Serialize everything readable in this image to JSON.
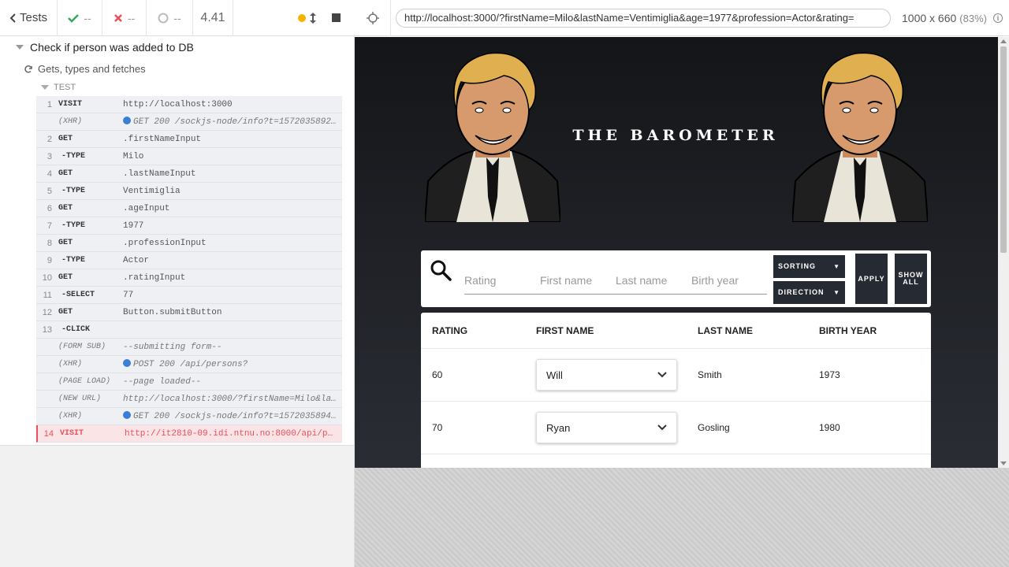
{
  "reporter": {
    "back_label": "Tests",
    "passed": "--",
    "failed": "--",
    "pending": "--",
    "duration": "4.41",
    "suite_title": "Check if person was added to DB",
    "test_title": "Gets, types and fetches",
    "section_label": "TEST",
    "commands": [
      {
        "num": "1",
        "name": "VISIT",
        "msg": "http://localhost:3000",
        "kind": "cmd"
      },
      {
        "num": "",
        "name": "(XHR)",
        "msg": "GET 200 /sockjs-node/info?t=1572035892…",
        "kind": "xhr"
      },
      {
        "num": "2",
        "name": "GET",
        "msg": ".firstNameInput",
        "kind": "cmd"
      },
      {
        "num": "3",
        "name": "-TYPE",
        "msg": "Milo",
        "kind": "child"
      },
      {
        "num": "4",
        "name": "GET",
        "msg": ".lastNameInput",
        "kind": "cmd"
      },
      {
        "num": "5",
        "name": "-TYPE",
        "msg": "Ventimiglia",
        "kind": "child"
      },
      {
        "num": "6",
        "name": "GET",
        "msg": ".ageInput",
        "kind": "cmd"
      },
      {
        "num": "7",
        "name": "-TYPE",
        "msg": "1977",
        "kind": "child"
      },
      {
        "num": "8",
        "name": "GET",
        "msg": ".professionInput",
        "kind": "cmd"
      },
      {
        "num": "9",
        "name": "-TYPE",
        "msg": "Actor",
        "kind": "child"
      },
      {
        "num": "10",
        "name": "GET",
        "msg": ".ratingInput",
        "kind": "cmd"
      },
      {
        "num": "11",
        "name": "-SELECT",
        "msg": "77",
        "kind": "child"
      },
      {
        "num": "12",
        "name": "GET",
        "msg": "Button.submitButton",
        "kind": "cmd"
      },
      {
        "num": "13",
        "name": "-CLICK",
        "msg": "",
        "kind": "child"
      },
      {
        "num": "",
        "name": "(FORM SUB)",
        "msg": "--submitting form--",
        "kind": "evt"
      },
      {
        "num": "",
        "name": "(XHR)",
        "msg": "POST 200 /api/persons?",
        "kind": "xhr"
      },
      {
        "num": "",
        "name": "(PAGE LOAD)",
        "msg": "--page loaded--",
        "kind": "evt"
      },
      {
        "num": "",
        "name": "(NEW URL)",
        "msg": "http://localhost:3000/?firstName=Milo&la…",
        "kind": "evt"
      },
      {
        "num": "",
        "name": "(XHR)",
        "msg": "GET 200 /sockjs-node/info?t=1572035894…",
        "kind": "xhr"
      },
      {
        "num": "14",
        "name": "VISIT",
        "msg": "http://it2810-09.idi.ntnu.no:8000/api/pe…",
        "kind": "failed"
      }
    ]
  },
  "aut": {
    "url": "http://localhost:3000/?firstName=Milo&lastName=Ventimiglia&age=1977&profession=Actor&rating=",
    "viewport": "1000 x 660",
    "scale": "(83%)",
    "info_icon": "i"
  },
  "app": {
    "title": "THE BAROMETER",
    "filters": {
      "rating": "Rating",
      "first_name": "First name",
      "last_name": "Last name",
      "birth_year": "Birth year"
    },
    "sorting_label": "SORTING",
    "direction_label": "DIRECTION",
    "apply_label": "APPLY",
    "show_all_label": "SHOW ALL",
    "table": {
      "headers": [
        "RATING",
        "FIRST NAME",
        "LAST NAME",
        "BIRTH YEAR"
      ],
      "rows": [
        {
          "rating": "60",
          "first": "Will",
          "last": "Smith",
          "year": "1973"
        },
        {
          "rating": "70",
          "first": "Ryan",
          "last": "Gosling",
          "year": "1980"
        }
      ]
    }
  },
  "colors": {
    "accent_pass": "#3aa55d",
    "accent_fail": "#e94f5c",
    "running": "#f5b300",
    "xhr_dot": "#3b7fd4",
    "app_button": "#262a33"
  }
}
